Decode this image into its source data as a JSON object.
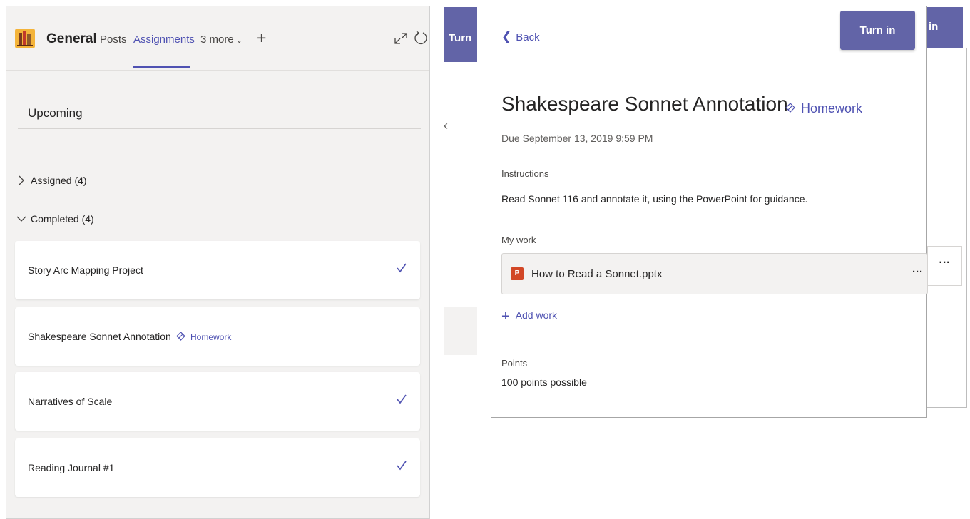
{
  "left_panel": {
    "channel": "General",
    "tabs": {
      "posts": "Posts",
      "assignments": "Assignments",
      "more": "3 more"
    },
    "section_title": "Upcoming",
    "groups": {
      "assigned": "Assigned (4)",
      "completed": "Completed (4)"
    },
    "cards": [
      {
        "title": "Story Arc Mapping Project",
        "completed": true
      },
      {
        "title": "Shakespeare Sonnet Annotation",
        "tag": "Homework",
        "completed": false
      },
      {
        "title": "Narratives of Scale",
        "completed": true
      },
      {
        "title": "Reading Journal #1",
        "completed": true
      }
    ]
  },
  "middle_strip": {
    "turn_button_partial": "Turn"
  },
  "right_background": {
    "button_partial": "in",
    "more_label": "···"
  },
  "detail": {
    "back_label": "Back",
    "turn_in_label": "Turn in",
    "title": "Shakespeare Sonnet Annotation",
    "tag": "Homework",
    "due": "Due September 13, 2019 9:59 PM",
    "instructions_label": "Instructions",
    "instructions": "Read Sonnet 116 and annotate it, using the PowerPoint for guidance.",
    "my_work_label": "My work",
    "file": {
      "name": "How to Read a Sonnet.pptx",
      "icon_letter": "P",
      "more_label": "···"
    },
    "add_work_label": "Add work",
    "points_label": "Points",
    "points": "100 points possible"
  },
  "colors": {
    "accent": "#4f52b2",
    "button": "#6264a7",
    "panel_bg": "#f3f2f1",
    "powerpoint": "#d24726"
  },
  "icons": {
    "team_logo": "books-icon",
    "expand": "expand-icon",
    "refresh": "refresh-icon",
    "add_tab": "plus-icon",
    "check": "checkmark-icon",
    "tag": "tag-icon",
    "file": "powerpoint-icon"
  }
}
